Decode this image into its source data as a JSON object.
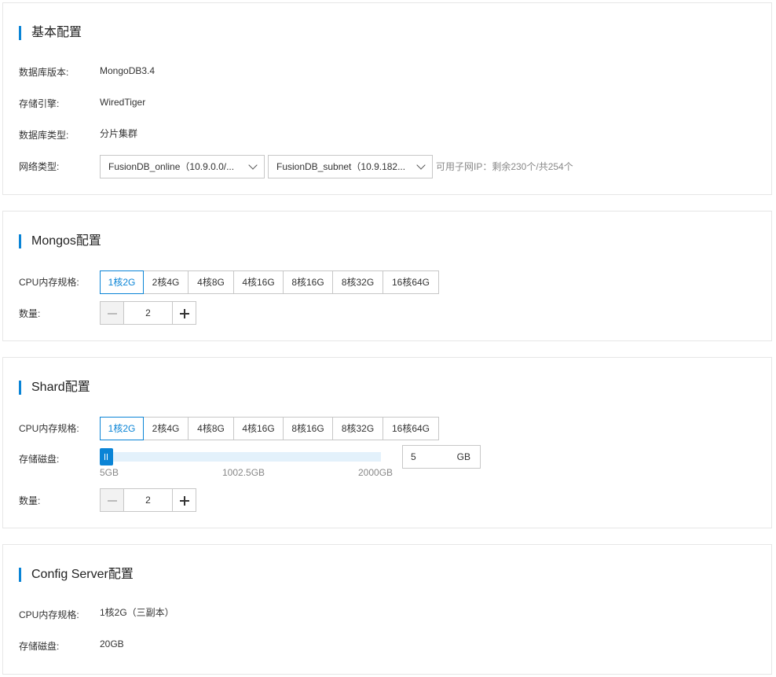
{
  "basic": {
    "title": "基本配置",
    "db_version_label": "数据库版本:",
    "db_version_value": "MongoDB3.4",
    "engine_label": "存储引擎:",
    "engine_value": "WiredTiger",
    "db_type_label": "数据库类型:",
    "db_type_value": "分片集群",
    "network_label": "网络类型:",
    "vpc_select": "FusionDB_online（10.9.0.0/...",
    "subnet_select": "FusionDB_subnet（10.9.182...",
    "ip_hint": "可用子网IP：剩余230个/共254个"
  },
  "mongos": {
    "title": "Mongos配置",
    "spec_label": "CPU内存规格:",
    "specs": [
      "1核2G",
      "2核4G",
      "4核8G",
      "4核16G",
      "8核16G",
      "8核32G",
      "16核64G"
    ],
    "selected_spec": "1核2G",
    "count_label": "数量:",
    "count_value": "2"
  },
  "shard": {
    "title": "Shard配置",
    "spec_label": "CPU内存规格:",
    "specs": [
      "1核2G",
      "2核4G",
      "4核8G",
      "4核16G",
      "8核16G",
      "8核32G",
      "16核64G"
    ],
    "selected_spec": "1核2G",
    "disk_label": "存储磁盘:",
    "disk_min": "5GB",
    "disk_mid": "1002.5GB",
    "disk_max": "2000GB",
    "disk_value": "5",
    "disk_unit": "GB",
    "disk_level": 0,
    "count_label": "数量:",
    "count_value": "2"
  },
  "config_server": {
    "title": "Config Server配置",
    "spec_label": "CPU内存规格:",
    "spec_value": "1核2G（三副本）",
    "disk_label": "存储磁盘:",
    "disk_value": "20GB"
  },
  "colors": {
    "accent": "#0a84d6",
    "border": "#c7c7c7",
    "slider_track": "#e3f1fb"
  },
  "icons": {
    "dropdown": "chevron-down-icon",
    "minus": "minus-icon",
    "plus": "plus-icon"
  }
}
